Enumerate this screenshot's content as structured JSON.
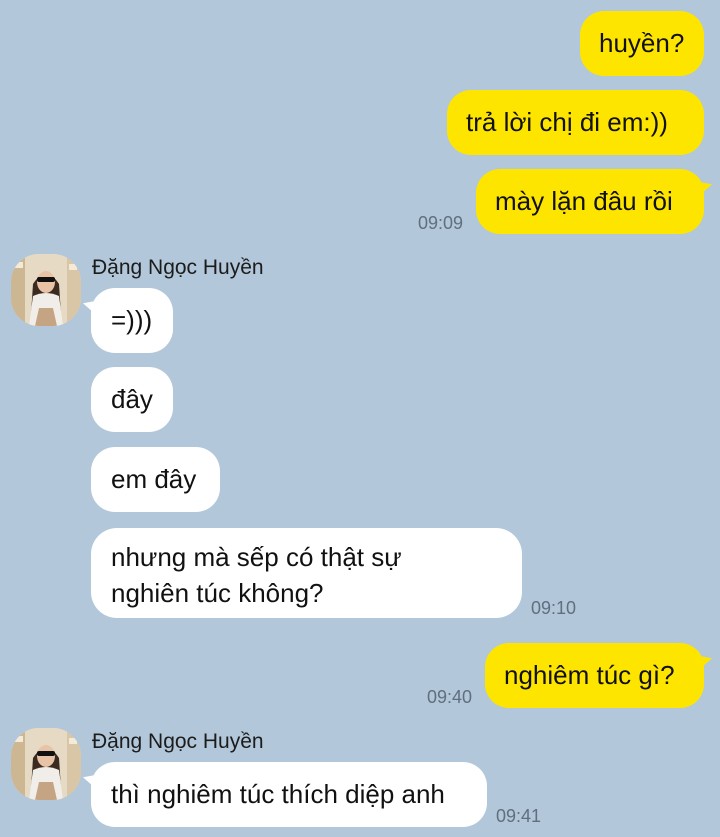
{
  "conversation": {
    "sent_1": "huyền?",
    "sent_2": "trả lời chị đi em:))",
    "sent_3": "mày lặn đâu rồi",
    "sent_time_1": "09:09",
    "contact_name": "Đặng Ngọc Huyền",
    "recv_1": "=)))",
    "recv_2": "đây",
    "recv_3": "em đây",
    "recv_4_line1": "nhưng mà sếp có thật sự",
    "recv_4_line2": "nghiên túc không?",
    "recv_time_1": "09:10",
    "sent_4": "nghiêm túc gì?",
    "sent_time_2": "09:40",
    "contact_name_2": "Đặng Ngọc Huyền",
    "recv_5": "thì nghiêm túc thích diệp anh",
    "recv_time_2": "09:41"
  },
  "colors": {
    "background": "#b2c7da",
    "sent_bubble": "#fee500",
    "received_bubble": "#ffffff"
  },
  "icons": {
    "avatar": "profile-photo-avatar"
  }
}
